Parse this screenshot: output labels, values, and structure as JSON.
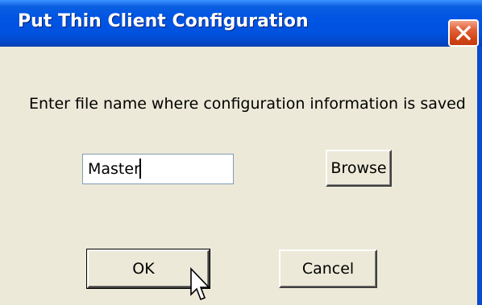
{
  "window": {
    "title": "Put Thin Client Configuration",
    "close_icon": "close-icon"
  },
  "dialog": {
    "prompt": "Enter file name where configuration information is saved",
    "file_name_value": "Master",
    "browse_label": "Browse",
    "ok_label": "OK",
    "cancel_label": "Cancel"
  },
  "colors": {
    "titlebar": "#0054e3",
    "client_area": "#ece9d8",
    "close_button": "#d14415"
  },
  "cursor_icon": "arrow-pointer-icon"
}
